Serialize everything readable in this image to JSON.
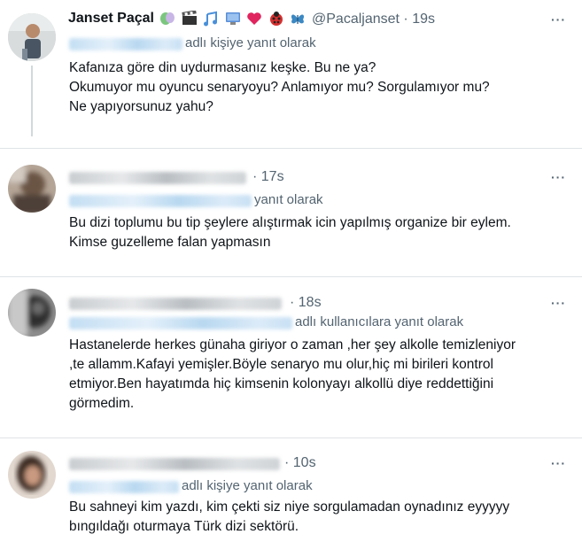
{
  "tweets": [
    {
      "author": "Janset Paçal",
      "handle": "@Pacaljanset",
      "time": "· 19s",
      "reply_suffix": "adlı kişiye yanıt olarak",
      "lines": [
        "Kafanıza göre din uydurmasanız keşke. Bu ne ya?",
        "Okumuyor mu oyuncu senaryoyu? Anlamıyor mu? Sorgulamıyor mu?",
        "Ne yapıyorsunuz yahu?"
      ],
      "emojis": [
        "theater-masks",
        "clapperboard",
        "music-notes",
        "monitor",
        "heart",
        "ladybug",
        "butterfly"
      ]
    },
    {
      "time": "· 17s",
      "reply_suffix": "yanıt olarak",
      "lines": [
        "Bu dizi toplumu bu tip şeylere alıştırmak icin yapılmış organize bir eylem.",
        "Kimse guzelleme falan yapmasın"
      ]
    },
    {
      "time": "· 18s",
      "reply_suffix": "adlı kullanıcılara yanıt olarak",
      "lines": [
        "Hastanelerde herkes günaha giriyor o  zaman ,her şey alkolle temizleniyor",
        ",te allamm.Kafayi yemişler.Böyle senaryo mu olur,hiç mi birileri kontrol",
        "etmiyor.Ben hayatımda hiç kimsenin kolonyayı alkollü diye reddettiğini",
        "görmedim."
      ]
    },
    {
      "time": "· 10s",
      "reply_suffix": "adlı kişiye yanıt olarak",
      "lines": [
        "Bu sahneyi kim yazdı, kim çekti siz niye sorgulamadan oynadınız eyyyyy",
        "bıngıldağı oturmaya Türk dizi sektörü."
      ]
    }
  ],
  "more_label": "···"
}
